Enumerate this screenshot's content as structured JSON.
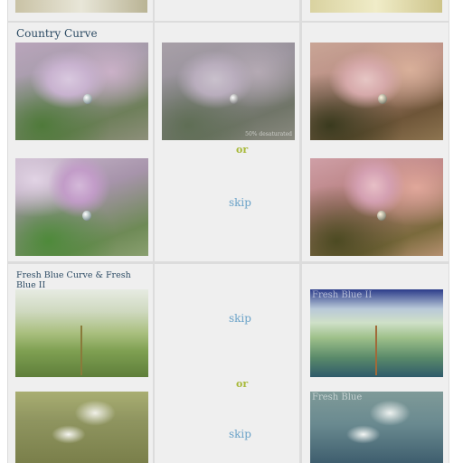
{
  "sections": {
    "country": {
      "title": "Country Curve",
      "or_label": "or",
      "skip_label": "skip",
      "desaturated_note": "50% desaturated"
    },
    "fresh_blue": {
      "title": "Fresh Blue Curve & Fresh Blue II",
      "skip_top": "skip",
      "skip_bottom": "skip",
      "or_label": "or",
      "watermark_top": "Fresh Blue II",
      "watermark_bottom": "Fresh Blue"
    }
  }
}
